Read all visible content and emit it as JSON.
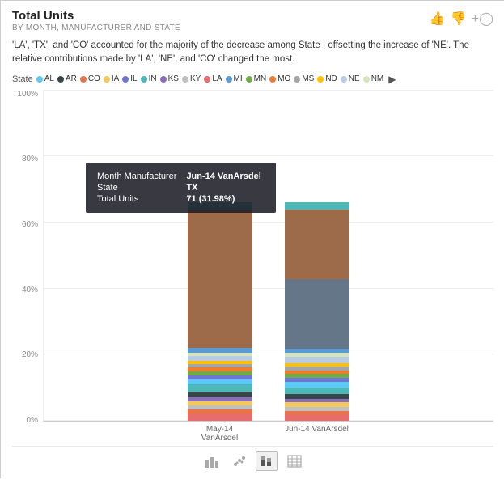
{
  "header": {
    "title": "Total Units",
    "subtitle": "BY MONTH, MANUFACTURER AND STATE",
    "icons": [
      "thumbs-up",
      "thumbs-down",
      "add"
    ]
  },
  "insight": "'LA', 'TX', and 'CO' accounted for the majority of the decrease among State , offsetting the increase of 'NE'. The relative contributions made by 'LA', 'NE', and 'CO' changed the most.",
  "legend": {
    "label": "State",
    "items": [
      {
        "id": "AL",
        "color": "#5bc8f5"
      },
      {
        "id": "AR",
        "color": "#374649"
      },
      {
        "id": "CO",
        "color": "#e8734a"
      },
      {
        "id": "IA",
        "color": "#f2c75c"
      },
      {
        "id": "IL",
        "color": "#6c76d4"
      },
      {
        "id": "IN",
        "color": "#4db8b8"
      },
      {
        "id": "KS",
        "color": "#8b6db8"
      },
      {
        "id": "KY",
        "color": "#c0c0c0"
      },
      {
        "id": "LA",
        "color": "#e86c6c"
      },
      {
        "id": "MI",
        "color": "#5b9bd5"
      },
      {
        "id": "MN",
        "color": "#70ad47"
      },
      {
        "id": "MO",
        "color": "#ed7d31"
      },
      {
        "id": "MS",
        "color": "#a5a5a5"
      },
      {
        "id": "ND",
        "color": "#ffc000"
      },
      {
        "id": "NE",
        "color": "#b8cce4"
      },
      {
        "id": "NM",
        "color": "#d6e4bc"
      }
    ]
  },
  "yAxis": [
    "100%",
    "80%",
    "60%",
    "40%",
    "20%",
    "0%"
  ],
  "bars": [
    {
      "label": "May-14 VanArsdel",
      "segments": [
        {
          "color": "#e86c6c",
          "height": 8
        },
        {
          "color": "#e8734a",
          "height": 6
        },
        {
          "color": "#c0c0c0",
          "height": 5
        },
        {
          "color": "#f2c75c",
          "height": 5
        },
        {
          "color": "#8b6db8",
          "height": 5
        },
        {
          "color": "#374649",
          "height": 7
        },
        {
          "color": "#4db8b8",
          "height": 9
        },
        {
          "color": "#5bc8f5",
          "height": 6
        },
        {
          "color": "#6c76d4",
          "height": 5
        },
        {
          "color": "#70ad47",
          "height": 5
        },
        {
          "color": "#ed7d31",
          "height": 5
        },
        {
          "color": "#a5a5a5",
          "height": 4
        },
        {
          "color": "#ffc000",
          "height": 4
        },
        {
          "color": "#b8cce4",
          "height": 6
        },
        {
          "color": "#d6e4bc",
          "height": 4
        },
        {
          "color": "#5b9bd5",
          "height": 6
        },
        {
          "color": "#9e6b4a",
          "height": 120
        }
      ]
    },
    {
      "label": "Jun-14 VanArsdel",
      "segments": [
        {
          "color": "#e86c6c",
          "height": 7
        },
        {
          "color": "#e8734a",
          "height": 5
        },
        {
          "color": "#c0c0c0",
          "height": 5
        },
        {
          "color": "#f2c75c",
          "height": 6
        },
        {
          "color": "#8b6db8",
          "height": 4
        },
        {
          "color": "#374649",
          "height": 6
        },
        {
          "color": "#4db8b8",
          "height": 8
        },
        {
          "color": "#5bc8f5",
          "height": 7
        },
        {
          "color": "#6c76d4",
          "height": 5
        },
        {
          "color": "#70ad47",
          "height": 5
        },
        {
          "color": "#ed7d31",
          "height": 4
        },
        {
          "color": "#a5a5a5",
          "height": 5
        },
        {
          "color": "#ffc000",
          "height": 4
        },
        {
          "color": "#b8cce4",
          "height": 8
        },
        {
          "color": "#d6e4bc",
          "height": 5
        },
        {
          "color": "#5b9bd5",
          "height": 5
        },
        {
          "color": "#9e6b4a",
          "height": 107
        }
      ]
    }
  ],
  "tooltip": {
    "label_month": "Month Manufacturer",
    "value_month": "Jun-14 VanArsdel",
    "label_state": "State",
    "value_state": "TX",
    "label_units": "Total Units",
    "value_units": "71 (31.98%)"
  },
  "toolbar": {
    "icons": [
      "bar-chart",
      "scatter",
      "stacked",
      "table"
    ]
  }
}
